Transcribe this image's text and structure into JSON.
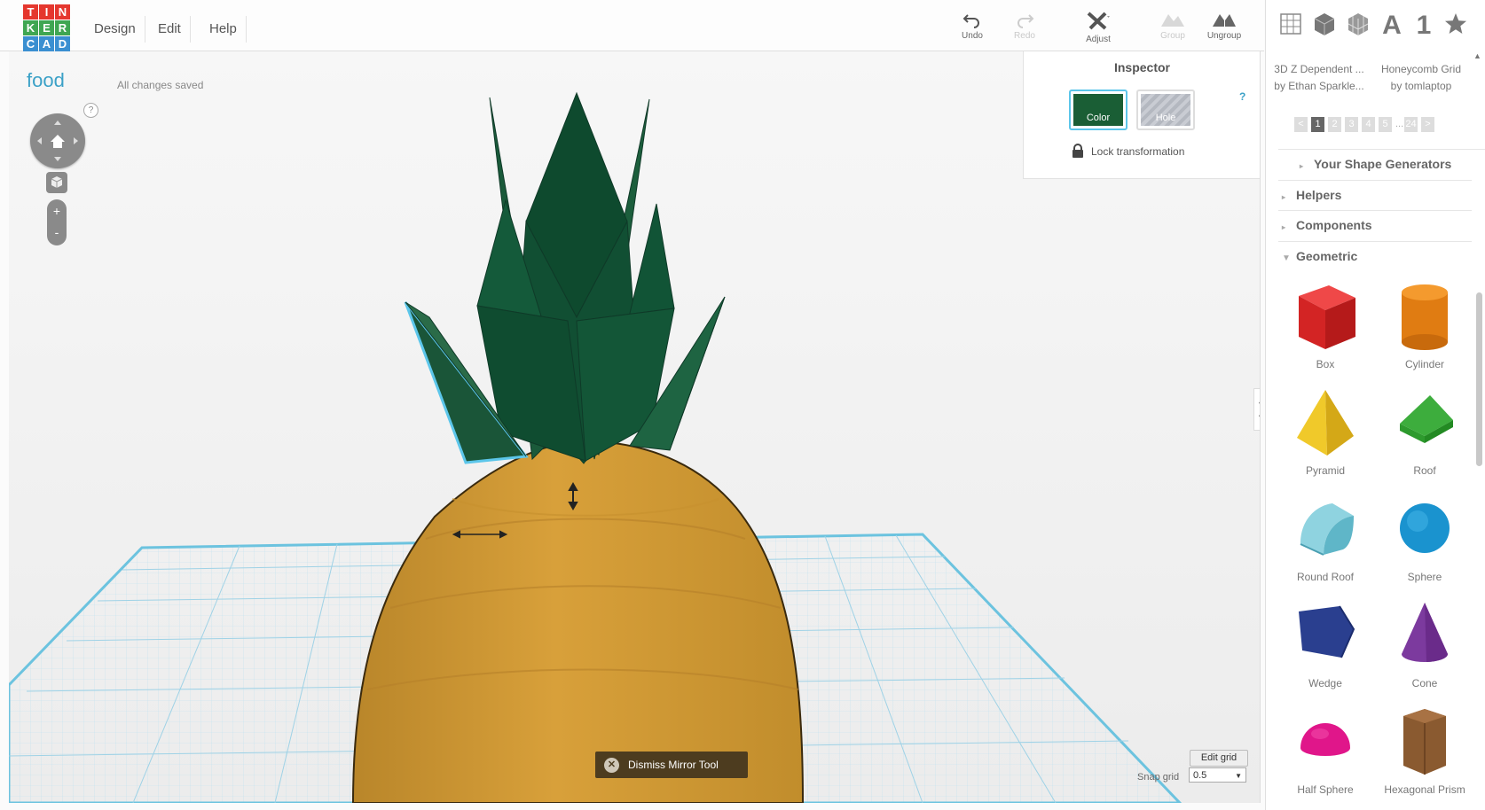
{
  "app": {
    "logo_letters": [
      "T",
      "I",
      "N",
      "K",
      "E",
      "R",
      "C",
      "A",
      "D"
    ],
    "logo_colors": [
      "#e5372e",
      "#e5372e",
      "#e5372e",
      "#3fa652",
      "#3fa652",
      "#3fa652",
      "#3a8fd1",
      "#3a8fd1",
      "#3a8fd1"
    ]
  },
  "menu": {
    "design": "Design",
    "edit": "Edit",
    "help": "Help"
  },
  "toolbar": {
    "undo": "Undo",
    "redo": "Redo",
    "adjust": "Adjust",
    "group": "Group",
    "ungroup": "Ungroup"
  },
  "document": {
    "title": "food",
    "save_status": "All changes saved"
  },
  "nav": {
    "help": "?",
    "zoom_in": "+",
    "zoom_out": "-"
  },
  "inspector": {
    "title": "Inspector",
    "color_label": "Color",
    "hole_label": "Hole",
    "help": "?",
    "lock_label": "Lock transformation",
    "selected_color": "#1a5e35"
  },
  "mirror": {
    "dismiss_label": "Dismiss Mirror Tool"
  },
  "grid": {
    "edit_label": "Edit grid",
    "snap_label": "Snap grid",
    "snap_value": "0.5"
  },
  "rightpanel": {
    "top_icons": [
      "workplane-icon",
      "box-icon",
      "wireframe-icon",
      "text-icon",
      "number-icon",
      "star-icon"
    ],
    "text_icon": "A",
    "number_icon": "1",
    "gallery": [
      {
        "line1": "3D Z Dependent ...",
        "line2": "by Ethan Sparkle..."
      },
      {
        "line1": "Honeycomb Grid",
        "line2": "by tomlaptop"
      }
    ],
    "pager": [
      "<",
      "1",
      "2",
      "3",
      "4",
      "5",
      "...",
      "24",
      ">"
    ],
    "sections": [
      "Your Shape Generators",
      "Helpers",
      "Components",
      "Geometric"
    ],
    "shapes": [
      "Box",
      "Cylinder",
      "Pyramid",
      "Roof",
      "Round Roof",
      "Sphere",
      "Wedge",
      "Cone",
      "Half Sphere",
      "Hexagonal Prism"
    ]
  }
}
